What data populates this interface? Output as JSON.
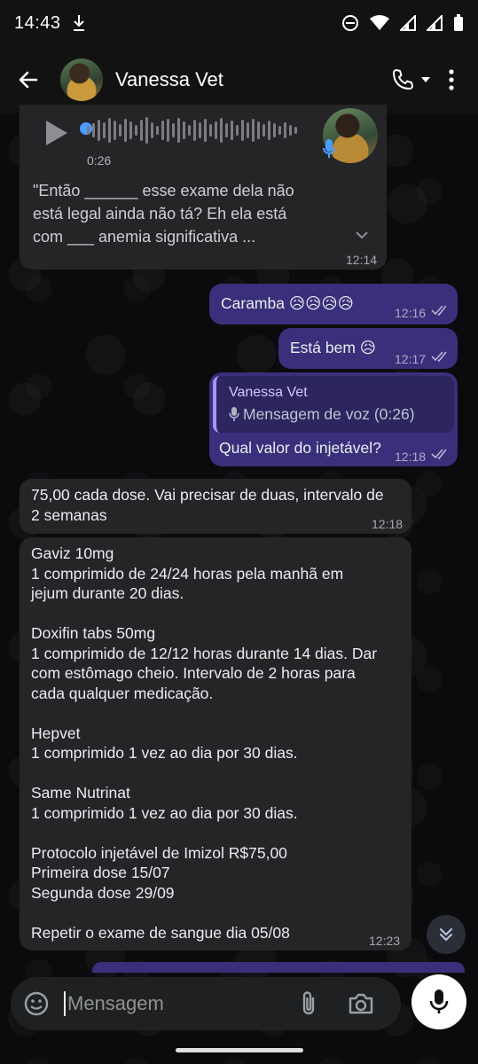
{
  "status_bar": {
    "time": "14:43"
  },
  "header": {
    "contact_name": "Vanessa Vet"
  },
  "messages": {
    "voice": {
      "duration": "0:26",
      "transcript": "\"Então ______ esse exame dela não\nestá legal ainda não tá? Eh ela está\ncom ___ anemia significativa ...",
      "time": "12:14"
    },
    "m1": {
      "text": "Caramba 😥😥😥😥",
      "time": "12:16"
    },
    "m2": {
      "text": "Está bem 😥",
      "time": "12:17"
    },
    "m3": {
      "quote_name": "Vanessa Vet",
      "quote_text": "Mensagem de voz (0:26)",
      "text": "Qual valor do injetável?",
      "time": "12:18"
    },
    "m4": {
      "text": "75,00 cada dose. Vai precisar de duas, intervalo de\n2 semanas",
      "time": "12:18"
    },
    "m5": {
      "text": "Gaviz 10mg\n1 comprimido de 24/24 horas pela manhã em\njejum durante 20 dias.\n\nDoxifin tabs 50mg\n1 comprimido de 12/12 horas durante 14 dias. Dar\ncom estômago cheio. Intervalo de 2 horas para\ncada qualquer medicação.\n\nHepvet\n1 comprimido 1 vez ao dia por 30 dias.\n\nSame Nutrinat\n1 comprimido 1 vez ao dia por 30 dias.\n\nProtocolo injetável de Imizol R$75,00\nPrimeira dose 15/07\nSegunda dose 29/09\n\nRepetir o exame de sangue dia 05/08",
      "time": "12:23"
    }
  },
  "composer": {
    "placeholder": "Mensagem"
  },
  "colors": {
    "incoming": "#252528",
    "outgoing": "#3a2f7a",
    "accent": "#4a9dff",
    "ticks": "#b8b3d9"
  }
}
